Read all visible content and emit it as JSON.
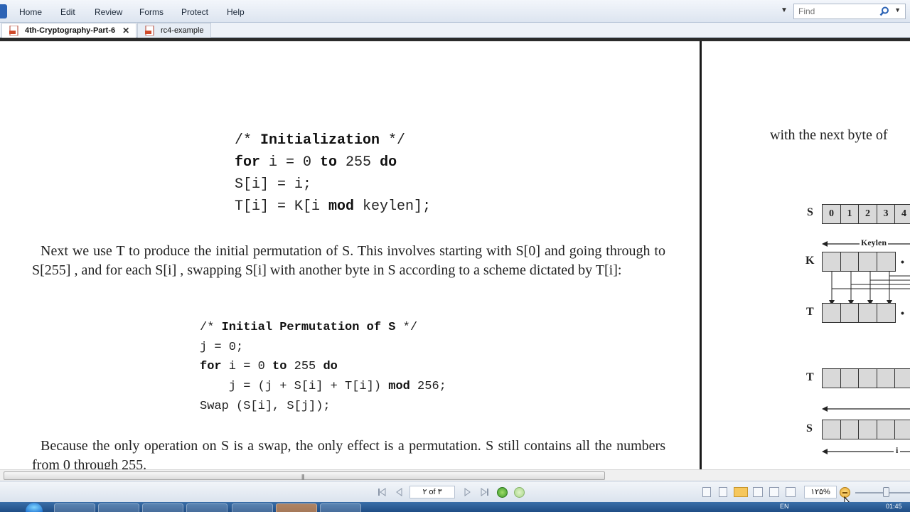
{
  "menu": {
    "items": [
      "Home",
      "Edit",
      "Review",
      "Forms",
      "Protect",
      "Help"
    ],
    "find_placeholder": "Find"
  },
  "tabs": [
    {
      "label": "4th-Cryptography-Part-6",
      "active": true
    },
    {
      "label": "rc4-example",
      "active": false
    }
  ],
  "document": {
    "init_comment_open": "/* ",
    "init_comment_title": "Initialization",
    "init_comment_close": " */",
    "init_lines": [
      {
        "kw1": "for",
        "mid": " i = 0 ",
        "kw2": "to",
        "end": " 255 ",
        "kw3": "do"
      },
      {
        "text": "S[i] = i;"
      },
      {
        "pre": "T[i] = K[i ",
        "kw": "mod",
        "post": " keylen];"
      }
    ],
    "paragraph1": "Next we use T to produce the initial permutation of S. This involves starting with S[0] and going through to S[255] , and for each S[i] , swapping S[i] with another byte in S according to a scheme dictated by T[i]:",
    "perm_comment_open": "/* ",
    "perm_comment_title": "Initial Permutation of S",
    "perm_comment_close": " */",
    "perm_lines": {
      "j_init": "j = 0;",
      "for_kw": "for",
      "for_mid": " i = 0 ",
      "to_kw": "to",
      "for_end": " 255 ",
      "do_kw": "do",
      "assign_pre": "    j = (j + S[i] + T[i]) ",
      "mod_kw": "mod",
      "assign_post": " 256;",
      "swap": "Swap (S[i], S[j]);"
    },
    "paragraph2": "Because the only operation on S is a swap, the only effect is a permutation. S still contains all the numbers from 0 through 255."
  },
  "right_page": {
    "text": "with the next byte of",
    "diagram": {
      "labels": [
        "S",
        "K",
        "T",
        "T",
        "S"
      ],
      "s_cells": [
        "0",
        "1",
        "2",
        "3",
        "4"
      ],
      "keylen_label": "Keylen",
      "i_label": "i"
    }
  },
  "statusbar": {
    "page_indicator": "۲ of ۳",
    "zoom": "۱۲۵%"
  },
  "taskbar": {
    "lang": "EN",
    "clock": "01:45"
  },
  "colors": {
    "accent": "#2c63b5",
    "active_view": "#f6c75c",
    "nav_green": "#4caf50"
  }
}
